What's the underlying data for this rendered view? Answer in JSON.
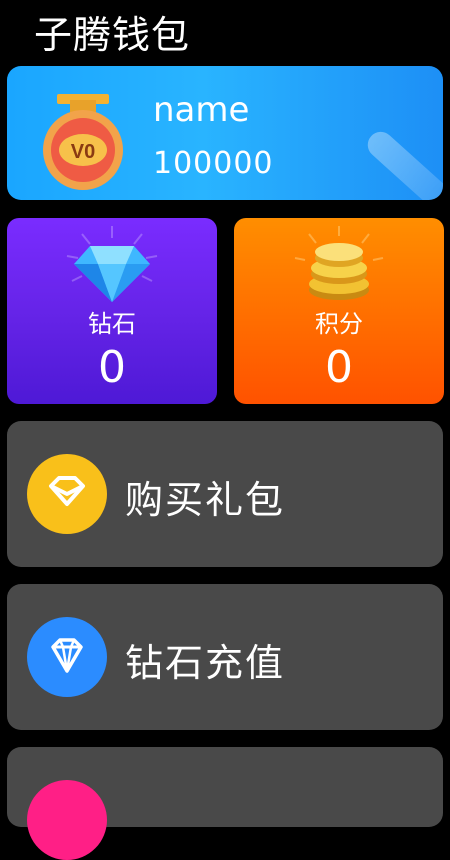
{
  "app": {
    "title": "子腾钱包"
  },
  "user": {
    "level_badge": "V0",
    "name": "name",
    "id": "100000"
  },
  "stats": [
    {
      "label": "钻石",
      "value": "0",
      "icon": "diamond-icon"
    },
    {
      "label": "积分",
      "value": "0",
      "icon": "coins-icon"
    }
  ],
  "menu": [
    {
      "label": "购买礼包",
      "icon": "gift-diamond-icon",
      "color": "#f9c01a"
    },
    {
      "label": "钻石充值",
      "icon": "diamond-recharge-icon",
      "color": "#2b8cff"
    },
    {
      "label": "",
      "icon": "circle-icon",
      "color": "#ff1f86"
    }
  ],
  "colors": {
    "background": "#000000",
    "user_card": "#1aa6ff",
    "diamond_card": "#6423e6",
    "points_card": "#ff6a00",
    "menu_bg": "#494949"
  }
}
